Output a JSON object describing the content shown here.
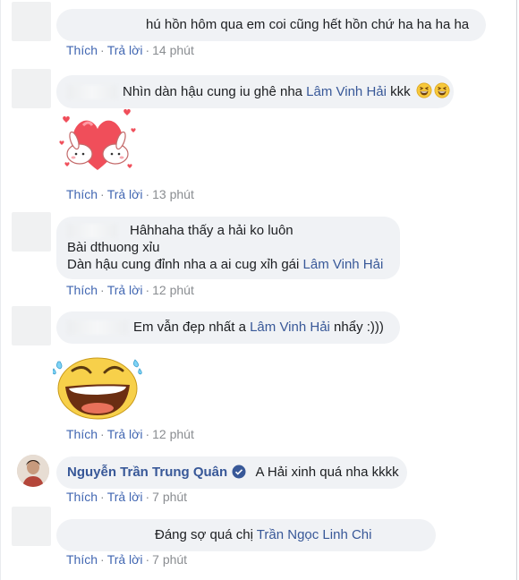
{
  "comments": [
    {
      "text": "hú hồn hôm qua em coi cũng hết hồn chứ ha ha ha ha",
      "like": "Thích",
      "reply": "Trả lời",
      "time": "14 phút"
    },
    {
      "text_before": "Nhìn dàn hậu cung iu ghê nha ",
      "mention": "Lâm Vinh Hải",
      "text_after": " kkk",
      "emoji": "grinning-squinting-face",
      "like": "Thích",
      "reply": "Trả lời",
      "time": "13 phút",
      "sticker": "bunnies-holding-heart"
    },
    {
      "line1": "Hâhhaha thấy a hải ko luôn",
      "line2": "Bài dthuong xỉu",
      "line3_before": "Dàn hậu cung đỉnh nha a ai cug xỉh gái ",
      "mention": "Lâm Vinh Hải",
      "like": "Thích",
      "reply": "Trả lời",
      "time": "12 phút"
    },
    {
      "text_before": "Em vẫn đẹp nhất a ",
      "mention": "Lâm Vinh Hải",
      "text_after": " nhẩy :)))",
      "like": "Thích",
      "reply": "Trả lời",
      "time": "12 phút",
      "sticker": "laughing-tears-face"
    },
    {
      "author": "Nguyễn Trần Trung Quân",
      "verified": true,
      "text": "A Hải xinh quá nha kkkk",
      "like": "Thích",
      "reply": "Trả lời",
      "time": "7 phút"
    },
    {
      "text_before": "Đáng sợ quá chị ",
      "mention": "Trần Ngọc Linh Chi",
      "like": "Thích",
      "reply": "Trả lời",
      "time": "7 phút"
    }
  ],
  "colors": {
    "link": "#385898",
    "action": "#4267b2",
    "meta": "#8a8d91",
    "bubble": "#f0f2f5"
  }
}
